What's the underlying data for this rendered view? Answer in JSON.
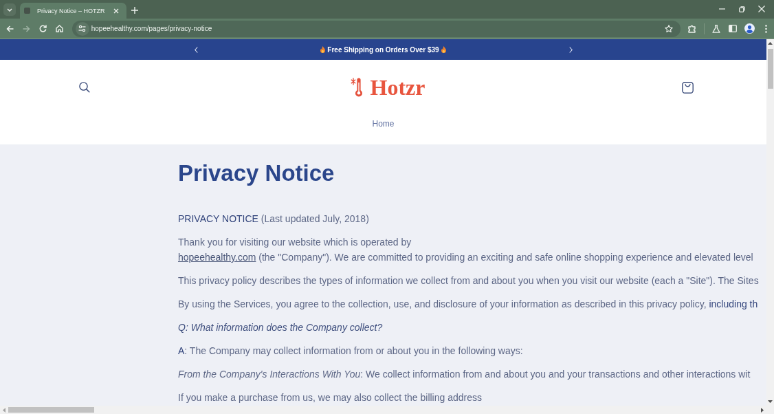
{
  "browser": {
    "tabs": [
      {
        "title": "Privacy Notice – HOTZR",
        "selected": true
      }
    ],
    "nav_buttons": [
      {
        "kind": "back",
        "disabled": false
      },
      {
        "kind": "forward",
        "disabled": true
      },
      {
        "kind": "reload",
        "disabled": false
      },
      {
        "kind": "home",
        "disabled": false
      }
    ],
    "url": "hopeehealthy.com/pages/privacy-notice"
  },
  "announcement": {
    "text": "Free Shipping on Orders Over $39"
  },
  "header": {
    "logo": "Hotzr",
    "nav": [
      "Home"
    ]
  },
  "page": {
    "title": "Privacy Notice",
    "paragraphs": [
      {
        "kind": "text",
        "text": "**PRIVACY NOTICE** (Last updated July, 2018)"
      },
      {
        "kind": "link_text",
        "before": "Thank you for visiting our website which is operated by",
        "link": "hopeehealthy.com",
        "after": " (the \"Company\"). We are committed to providing an exciting and safe online shopping experience and elevated level"
      },
      {
        "kind": "text",
        "text": "This privacy policy describes the types of information we collect from and about you when you visit our website (each a \"Site\"). The Sites"
      },
      {
        "kind": "text",
        "text": "By using the Services, you agree to the collection, use, and disclosure of your information as described in this privacy policy, **including th**"
      },
      {
        "kind": "question",
        "text": "Q: What information does the Company collect?"
      },
      {
        "kind": "text",
        "text": "**A**: The Company may collect information from or about you in the following ways:"
      },
      {
        "kind": "text",
        "text": "*From the Company's Interactions With You*: We collect information from and about you and your transactions and other interactions wit"
      },
      {
        "kind": "text",
        "text": "If you make a purchase from us, we may also collect the billing address"
      }
    ]
  }
}
